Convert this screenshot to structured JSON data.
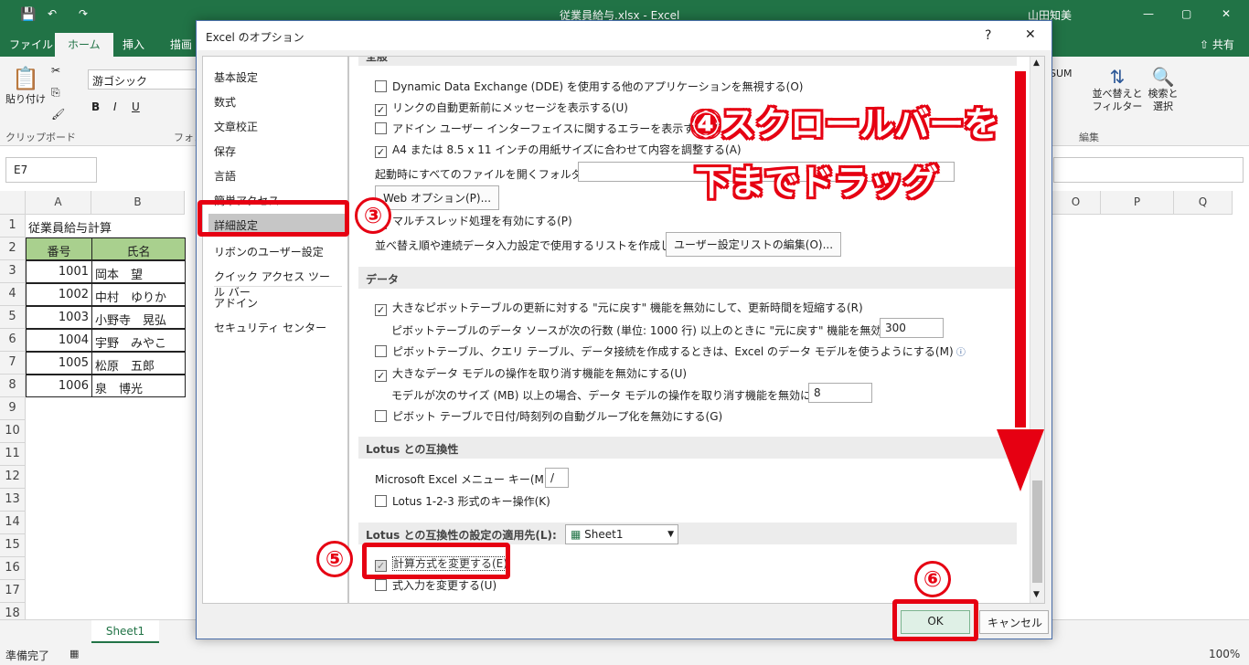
{
  "excel": {
    "title": "従業員給与.xlsx  -  Excel",
    "user": "山田知美",
    "tabs": [
      "ファイル",
      "ホーム",
      "挿入",
      "描画"
    ],
    "share": "共有",
    "font_name": "游ゴシック",
    "clipboard_group": "クリップボード",
    "font_group_partial": "フォン",
    "paste_label": "貼り付け",
    "sort_label": "並べ替えと\nフィルター",
    "find_label": "検索と\n選択",
    "edit_group": "編集",
    "sum_label": "SUM",
    "name_box": "E7",
    "columns": [
      "A",
      "B",
      "O",
      "P",
      "Q"
    ],
    "rows": [
      "1",
      "2",
      "3",
      "4",
      "5",
      "6",
      "7",
      "8",
      "9",
      "10",
      "11",
      "12",
      "13",
      "14",
      "15",
      "16",
      "17",
      "18"
    ],
    "a1": "従業員給与計算",
    "headers": [
      "番号",
      "氏名"
    ],
    "data": [
      [
        "1001",
        "岡本　望"
      ],
      [
        "1002",
        "中村　ゆりか"
      ],
      [
        "1003",
        "小野寺　晃弘"
      ],
      [
        "1004",
        "宇野　みやこ"
      ],
      [
        "1005",
        "松原　五郎"
      ],
      [
        "1006",
        "泉　博光"
      ]
    ],
    "sheet_tab": "Sheet1",
    "status": "準備完了",
    "zoom": "100%"
  },
  "dialog": {
    "title": "Excel のオプション",
    "help": "?",
    "close": "✕",
    "nav": [
      "基本設定",
      "数式",
      "文章校正",
      "保存",
      "言語",
      "簡単アクセス",
      "詳細設定",
      "リボンのユーザー設定",
      "クイック アクセス ツール バー",
      "アドイン",
      "セキュリティ センター"
    ],
    "section_top_partial": "全般",
    "general_opts": [
      {
        "label": "Dynamic Data Exchange (DDE) を使用する他のアプリケーションを無視する(O)",
        "checked": false
      },
      {
        "label": "リンクの自動更新前にメッセージを表示する(U)",
        "checked": true
      },
      {
        "label": "アドイン ユーザー インターフェイスに関するエラーを表示する(U)",
        "checked": false
      },
      {
        "label": "A4 または 8.5 x 11 インチの用紙サイズに合わせて内容を調整する(A)",
        "checked": true
      }
    ],
    "startup_folder_label": "起動時にすべてのファイルを開くフォルダー(L):",
    "web_options": "Web オプション(P)...",
    "multithread": "マルチスレッド処理を有効にする(P)",
    "sort_list_label": "並べ替え順や連続データ入力設定で使用するリストを作成します:",
    "sort_list_button": "ユーザー設定リストの編集(O)...",
    "data_section": "データ",
    "data_opts": [
      {
        "label": "大きなピボットテーブルの更新に対する \"元に戻す\" 機能を無効にして、更新時間を短縮する(R)",
        "checked": true
      },
      {
        "label": "ピボットテーブル、クエリ テーブル、データ接続を作成するときは、Excel のデータ モデルを使うようにする(M)",
        "checked": false
      },
      {
        "label": "大きなデータ モデルの操作を取り消す機能を無効にする(U)",
        "checked": true
      },
      {
        "label": "ピボット テーブルで日付/時刻列の自動グループ化を無効にする(G)",
        "checked": false
      }
    ],
    "pivot_rows_label": "ピボットテーブルのデータ ソースが次の行数 (単位: 1000 行) 以上のときに \"元に戻す\" 機能を無効にする(N):",
    "pivot_rows_value": "300",
    "model_size_label": "モデルが次のサイズ (MB) 以上の場合、データ モデルの操作を取り消す機能を無効にする(L):",
    "model_size_value": "8",
    "lotus_section": "Lotus との互換性",
    "menu_key_label": "Microsoft Excel メニュー キー(M):",
    "menu_key_value": "/",
    "lotus_keys": "Lotus 1-2-3 形式のキー操作(K)",
    "lotus_settings_section": "Lotus との互換性の設定の適用先(L):",
    "lotus_sheet": "Sheet1",
    "calc_change": "計算方式を変更する(E)",
    "formula_entry": "式入力を変更する(U)",
    "ok": "OK",
    "cancel": "キャンセル"
  },
  "annotations": {
    "step3": "③",
    "step4_line1": "④スクロールバーを",
    "step4_line2": "下までドラッグ",
    "step5": "⑤",
    "step6": "⑥"
  }
}
